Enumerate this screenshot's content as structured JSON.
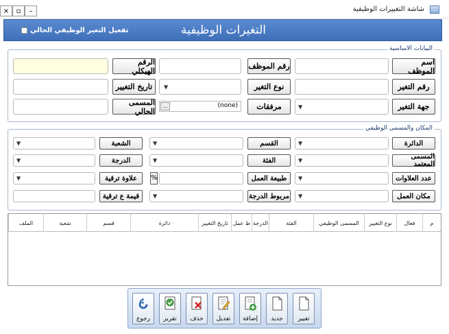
{
  "window": {
    "title": "شاشة التغييرات الوظيفية",
    "min_glyph": "–",
    "max_glyph": "▫",
    "close_glyph": "×"
  },
  "header": {
    "title": "التغيرات الوظيفية",
    "checkbox_label": "تفعيل التغير الوظيفي الحالي"
  },
  "basic_group": {
    "title": "البيانات الاساسية",
    "labels": {
      "employee_name": "اسم الموظف",
      "employee_no": "رقم الموظف",
      "structural_no": "الرقم الهيكلي",
      "change_no": "رقم التغير",
      "change_type": "نوع التغير",
      "change_date": "تاريخ التغيير",
      "change_authority": "جهة التغير",
      "attachments": "مرفقات",
      "current_title": "المسمى الحالي"
    },
    "attachments_value": "(none)",
    "browse_glyph": "..."
  },
  "place_group": {
    "title": "المكان والمسمى الوظيفي",
    "labels": {
      "department": "الدائرة",
      "section": "القسم",
      "division": "الشعبة",
      "approved_title": "المسمى المعتمد",
      "category": "الفئة",
      "grade": "الدرجة",
      "allowances_count": "عدد العلاوات",
      "work_nature": "طبيعة العمل",
      "promotion_allowance": "علاوة ترقية",
      "workplace": "مكان العمل",
      "grade_link": "مربوط الدرجة",
      "promotion_value": "قيمة ع ترقية"
    },
    "percent_glyph": "%"
  },
  "grid": {
    "columns": [
      "م",
      "فعال",
      "نوع التغيير",
      "المسمى الوظيفي",
      "الفئة",
      "الدرجة",
      "ط عمل",
      "تاريخ التغيير",
      "دائرة",
      "قسم",
      "شعبة",
      "الملف"
    ]
  },
  "toolbar": {
    "change": "تغيير",
    "new": "جديد",
    "add": "إضافة",
    "edit": "تعديل",
    "delete": "حذف",
    "report": "تقرير",
    "back": "رجوع"
  },
  "colors": {
    "header_blue": "#4a7cc4",
    "structural_field_bg": "#ffffe0",
    "focus_border": "#2d6ec9"
  }
}
